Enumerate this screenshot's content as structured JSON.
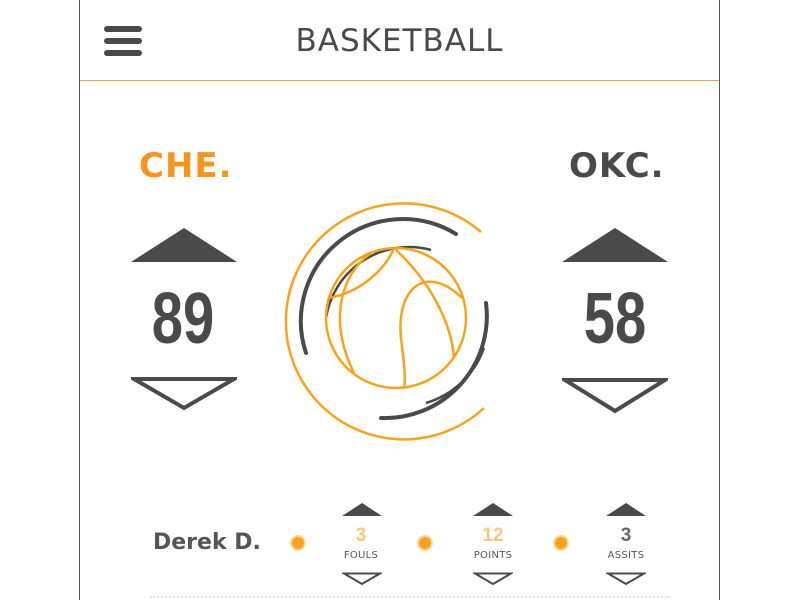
{
  "header": {
    "title": "BASKETBALL",
    "menu_icon": "hamburger-menu-icon"
  },
  "teams": {
    "home": {
      "name": "CHE.",
      "score": "89",
      "color": "#f7941d"
    },
    "away": {
      "name": "OKC.",
      "score": "58",
      "color": "#4a4a4a"
    }
  },
  "center_icon": "basketball-icon",
  "player": {
    "name": "Derek D.",
    "stats": [
      {
        "value": "3",
        "label": "FOULS",
        "color": "#f7c97a"
      },
      {
        "value": "12",
        "label": "POINTS",
        "color": "#f7c97a"
      },
      {
        "value": "3",
        "label": "ASSITS",
        "color": "#666666"
      }
    ]
  },
  "colors": {
    "accent": "#f7a31c",
    "dark": "#4a4a4a"
  }
}
